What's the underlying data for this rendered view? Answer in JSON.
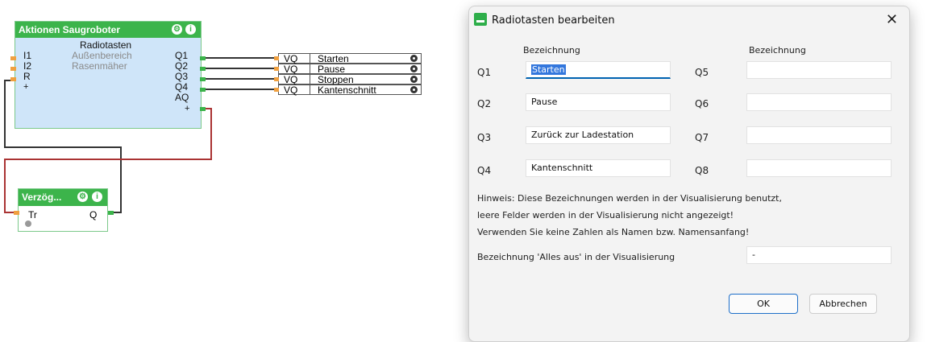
{
  "editor": {
    "block_main": {
      "title": "Aktionen Saugroboter",
      "subtitle": "Radiotasten",
      "inputs": [
        "I1",
        "I2",
        "R",
        "+"
      ],
      "input_descriptions": [
        "Außenbereich",
        "Rasenmäher"
      ],
      "outputs": [
        "Q1",
        "Q2",
        "Q3",
        "Q4",
        "AQ"
      ],
      "add_output": "+"
    },
    "vq_blocks": [
      {
        "type": "VQ",
        "name": "Starten"
      },
      {
        "type": "VQ",
        "name": "Pause"
      },
      {
        "type": "VQ",
        "name": "Stoppen"
      },
      {
        "type": "VQ",
        "name": "Kantenschnitt"
      }
    ],
    "block_delay": {
      "title": "Verzög...",
      "input": "Tr",
      "output": "Q"
    }
  },
  "dialog": {
    "title": "Radiotasten bearbeiten",
    "close_glyph": "✕",
    "header_left": "Bezeichnung",
    "header_right": "Bezeichnung",
    "left": [
      {
        "label": "Q1",
        "value": "Starten"
      },
      {
        "label": "Q2",
        "value": "Pause"
      },
      {
        "label": "Q3",
        "value": "Zurück zur Ladestation"
      },
      {
        "label": "Q4",
        "value": "Kantenschnitt"
      }
    ],
    "right": [
      {
        "label": "Q5",
        "value": ""
      },
      {
        "label": "Q6",
        "value": ""
      },
      {
        "label": "Q7",
        "value": ""
      },
      {
        "label": "Q8",
        "value": ""
      }
    ],
    "hint_lines": [
      "Hinweis: Diese Bezeichnungen werden in der Visualisierung benutzt,",
      "leere Felder werden in der Visualisierung nicht angezeigt!",
      "Verwenden Sie keine Zahlen als Namen bzw. Namensanfang!"
    ],
    "all_off_label": "Bezeichnung 'Alles aus' in der Visualisierung",
    "all_off_value": "-",
    "ok_label": "OK",
    "cancel_label": "Abbrechen"
  },
  "colors": {
    "block_green": "#3cb44b",
    "block_body": "#cfe5f9",
    "wire_dark": "#333333",
    "wire_red": "#b03030",
    "accent": "#0063b1"
  }
}
